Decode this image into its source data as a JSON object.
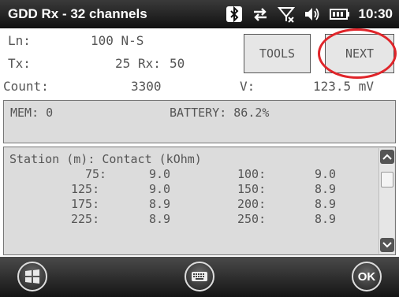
{
  "titlebar": {
    "title": "GDD Rx - 32 channels",
    "time": "10:30",
    "icons": [
      "bluetooth-icon",
      "sync-arrows-icon",
      "no-signal-icon",
      "volume-icon",
      "battery-icon"
    ]
  },
  "form": {
    "ln_label": "Ln:",
    "ln_value": "100 N-S",
    "tx_label": "Tx:",
    "tx_value": "25",
    "rx_label": "Rx:",
    "rx_value": "50",
    "count_label": "Count:",
    "count_value": "3300",
    "v_label": "V:",
    "v_value": "123.5 mV"
  },
  "buttons": {
    "tools": "TOOLS",
    "next": "NEXT"
  },
  "status": {
    "mem": "MEM: 0",
    "battery": "BATTERY: 86.2%"
  },
  "list": {
    "header": "Station (m): Contact (kOhm)",
    "rows": [
      {
        "s1": "75:",
        "c1": "9.0",
        "s2": "100:",
        "c2": "9.0"
      },
      {
        "s1": "125:",
        "c1": "9.0",
        "s2": "150:",
        "c2": "8.9"
      },
      {
        "s1": "175:",
        "c1": "8.9",
        "s2": "200:",
        "c2": "8.9"
      },
      {
        "s1": "225:",
        "c1": "8.9",
        "s2": "250:",
        "c2": "8.9"
      }
    ]
  },
  "bottombar": {
    "ok": "OK"
  },
  "colors": {
    "highlight_ring": "#e0252a",
    "panel_bg": "#dcdcdc",
    "titlebar_bg": "#1a1a1a"
  }
}
